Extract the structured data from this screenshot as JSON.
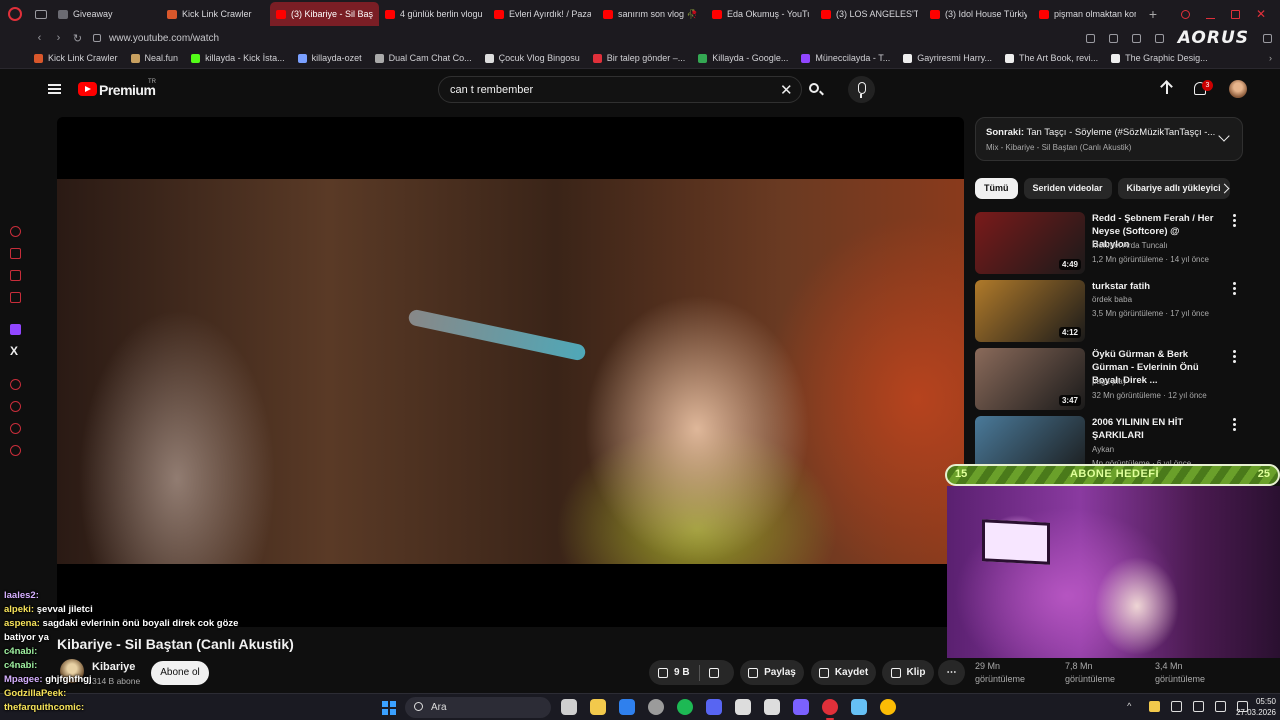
{
  "browser": {
    "tabs": [
      {
        "label": "Giveaway",
        "color": "#6b6b72",
        "active": false
      },
      {
        "label": "Kick Link Crawler",
        "color": "#d9572b",
        "active": false
      },
      {
        "label": "(3) Kibariye - Sil Başta",
        "color": "#ff0000",
        "active": true
      },
      {
        "label": "4 günlük berlin vlogu",
        "color": "#ff0000",
        "active": false
      },
      {
        "label": "Evleri Ayırdık! / Pazar",
        "color": "#ff0000",
        "active": false
      },
      {
        "label": "sanırım son vlog 🥀 | y",
        "color": "#ff0000",
        "active": false
      },
      {
        "label": "Eda Okumuş - YouTu",
        "color": "#ff0000",
        "active": false
      },
      {
        "label": "(3) LOS ANGELES'TA",
        "color": "#ff0000",
        "active": false
      },
      {
        "label": "(3) Idol House Türkiy",
        "color": "#ff0000",
        "active": false
      },
      {
        "label": "pişman olmaktan kor",
        "color": "#ff0000",
        "active": false
      }
    ],
    "new_tab_label": "+",
    "url": "www.youtube.com/watch",
    "brand_logo": "AORUS",
    "bookmarks": [
      {
        "label": "Kick Link Crawler",
        "color": "#d9572b"
      },
      {
        "label": "Neal.fun",
        "color": "#c8a060"
      },
      {
        "label": "killayda - Kick İsta...",
        "color": "#53fc18"
      },
      {
        "label": "killayda-ozet",
        "color": "#7aa0ff"
      },
      {
        "label": "Dual Cam Chat Co...",
        "color": "#aaaaaa"
      },
      {
        "label": "Çocuk Vlog Bingosu",
        "color": "#dddddd"
      },
      {
        "label": "Bir talep gönder –...",
        "color": "#e0303a"
      },
      {
        "label": "Killayda - Google...",
        "color": "#34a853"
      },
      {
        "label": "Müneccilayda - T...",
        "color": "#9146ff"
      },
      {
        "label": "Gayriresmi Harry...",
        "color": "#eeeeee"
      },
      {
        "label": "The Art Book, revi...",
        "color": "#eeeeee"
      },
      {
        "label": "The Graphic Desig...",
        "color": "#eeeeee"
      }
    ]
  },
  "youtube": {
    "brand": "Premium",
    "region": "TR",
    "search_query": "can t rembember",
    "notification_count": "3",
    "video": {
      "title": "Kibariye - Sil Baştan (Canlı Akustik)",
      "channel": "Kibariye",
      "subscribers": "314 B abone",
      "subscribe_label": "Abone ol",
      "likes": "9 B",
      "share_label": "Paylaş",
      "save_label": "Kaydet",
      "clip_label": "Klip"
    },
    "up_next": {
      "prefix": "Sonraki:",
      "title": "Tan Taşçı - Söyleme (#SözMüzikTanTaşçı -...",
      "subtitle": "Mix - Kibariye - Sil Baştan (Canlı Akustik)"
    },
    "chips": [
      {
        "label": "Tümü",
        "selected": true
      },
      {
        "label": "Seriden videolar",
        "selected": false
      },
      {
        "label": "Kibariye adlı yükleyici",
        "selected": false
      }
    ],
    "recommendations": [
      {
        "title": "Redd - Şebnem Ferah / Her Neyse (Softcore) @ Babylon",
        "channel": "Mehmet Arda Tuncalı",
        "meta": "1,2 Mn görüntüleme · 14 yıl önce",
        "duration": "4:49",
        "thumb": "#7a1a1a"
      },
      {
        "title": "turkstar fatih",
        "channel": "ördek baba",
        "meta": "3,5 Mn görüntüleme · 17 yıl önce",
        "duration": "4:12",
        "thumb": "#b07a2a"
      },
      {
        "title": "Öykü Gürman & Berk Gürman - Evlerinin Önü Boyalı Direk ...",
        "channel": "paga play",
        "meta": "32 Mn görüntüleme · 12 yıl önce",
        "duration": "3:47",
        "thumb": "#8a6a5a"
      },
      {
        "title": "2006 YILININ EN HİT ŞARKILARI",
        "channel": "Aykan",
        "meta": "Mn görüntüleme · 6 yıl önce",
        "duration": "",
        "thumb": "#4a7a9a"
      }
    ],
    "views_row": [
      {
        "count": "29 Mn",
        "label": "görüntüleme"
      },
      {
        "count": "7,8 Mn",
        "label": "görüntüleme"
      },
      {
        "count": "3,4 Mn",
        "label": "görüntüleme"
      }
    ]
  },
  "stream_overlay": {
    "goal_current": "15",
    "goal_label": "ABONE HEDEFİ",
    "goal_target": "25",
    "chat": [
      {
        "user": "laales2:",
        "msg": "",
        "cls": "u1"
      },
      {
        "user": "alpeki:",
        "msg": "şevval jiletci",
        "cls": "u2"
      },
      {
        "user": "aspena:",
        "msg": "sagdaki evlerinin önü boyali direk cok göze",
        "cls": "u2"
      },
      {
        "user": "",
        "msg": "batiyor ya",
        "cls": "u3"
      },
      {
        "user": "c4nabi:",
        "msg": "",
        "cls": "u4"
      },
      {
        "user": "c4nabi:",
        "msg": "",
        "cls": "u4"
      },
      {
        "user": "Mpagee:",
        "msg": "ghjfghfhgj",
        "cls": "u1"
      },
      {
        "user": "GodzillaPeek:",
        "msg": "",
        "cls": "u2"
      },
      {
        "user": "thefarquithcomic:",
        "msg": "",
        "cls": "u2"
      }
    ]
  },
  "taskbar": {
    "search_placeholder": "Ara",
    "time": "05:50",
    "date": "27.03.2026",
    "apps": [
      {
        "name": "files-icon",
        "color": "#cfcfcf"
      },
      {
        "name": "folder-icon",
        "color": "#f2c94c"
      },
      {
        "name": "mail-icon",
        "color": "#2f80ed"
      },
      {
        "name": "settings-icon",
        "color": "#9b9b9b"
      },
      {
        "name": "spotify-icon",
        "color": "#1db954"
      },
      {
        "name": "discord-icon",
        "color": "#5865f2"
      },
      {
        "name": "obs-icon",
        "color": "#dddddd"
      },
      {
        "name": "app-c-icon",
        "color": "#dddddd"
      },
      {
        "name": "grid-app-icon",
        "color": "#7b61ff"
      },
      {
        "name": "opera-icon",
        "color": "#e0303a"
      },
      {
        "name": "steam-icon",
        "color": "#66c0f4"
      },
      {
        "name": "chrome-icon",
        "color": "#fbbc05"
      }
    ]
  }
}
